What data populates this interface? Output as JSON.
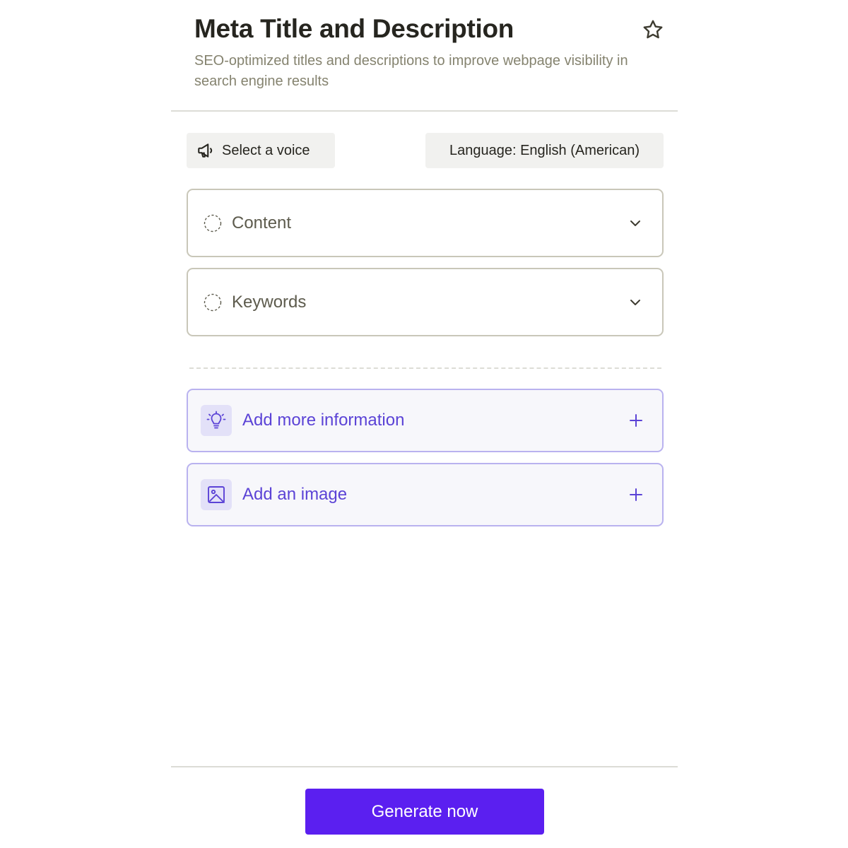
{
  "header": {
    "title": "Meta Title and Description",
    "subtitle": "SEO-optimized titles and descriptions to improve webpage visibility in search engine results",
    "favorite_icon": "star-icon"
  },
  "controls": {
    "voice_label": "Select a voice",
    "voice_icon": "megaphone-icon",
    "language_label": "Language: English (American)"
  },
  "fields": [
    {
      "label": "Content",
      "icon": "dashed-circle-icon",
      "expand_icon": "chevron-down-icon"
    },
    {
      "label": "Keywords",
      "icon": "dashed-circle-icon",
      "expand_icon": "chevron-down-icon"
    }
  ],
  "extras": [
    {
      "label": "Add more information",
      "icon": "lightbulb-icon",
      "action_icon": "plus-icon"
    },
    {
      "label": "Add an image",
      "icon": "image-icon",
      "action_icon": "plus-icon"
    }
  ],
  "footer": {
    "generate_label": "Generate now"
  },
  "colors": {
    "accent": "#5b1ff0",
    "accent_text": "#5b43d6",
    "accent_border": "#b9b2ef",
    "muted_text": "#85836f"
  }
}
